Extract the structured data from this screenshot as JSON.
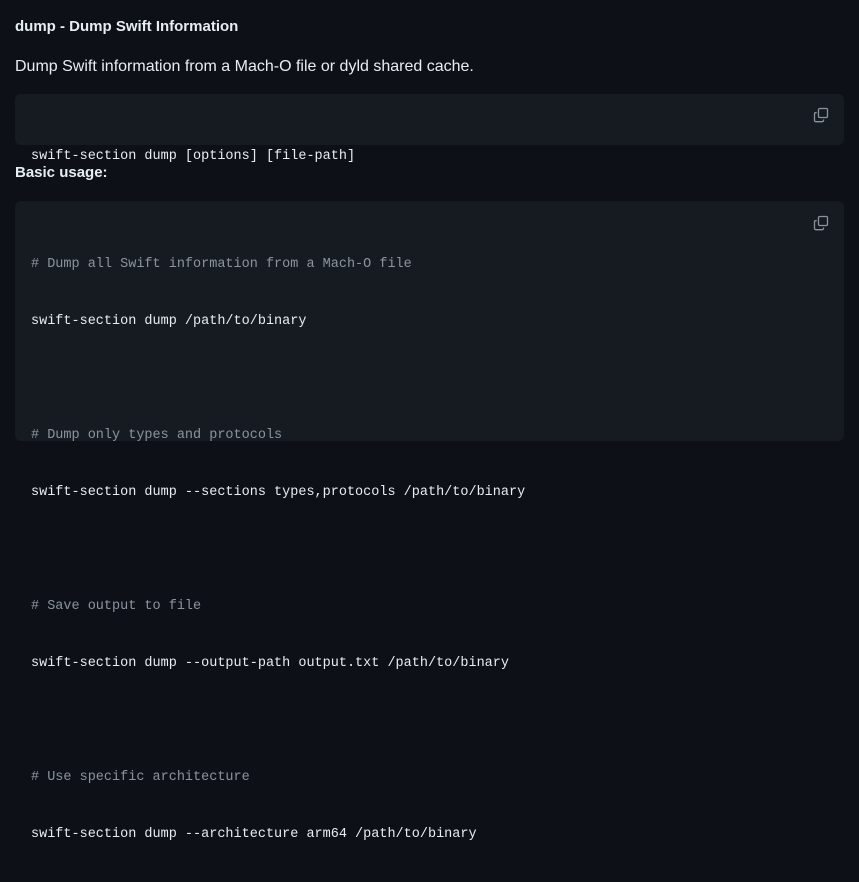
{
  "section": {
    "heading": "dump - Dump Swift Information",
    "description": "Dump Swift information from a Mach-O file or dyld shared cache."
  },
  "usage_block": {
    "command": "swift-section dump [options] [file-path]",
    "copy_icon": "copy-icon"
  },
  "basic_usage": {
    "heading": "Basic usage:",
    "copy_icon": "copy-icon",
    "examples": [
      {
        "comment": "# Dump all Swift information from a Mach-O file",
        "command": "swift-section dump /path/to/binary"
      },
      {
        "comment": "# Dump only types and protocols",
        "command": "swift-section dump --sections types,protocols /path/to/binary"
      },
      {
        "comment": "# Save output to file",
        "command": "swift-section dump --output-path output.txt /path/to/binary"
      },
      {
        "comment": "# Use specific architecture",
        "command": "swift-section dump --architecture arm64 /path/to/binary"
      }
    ]
  },
  "colors": {
    "page_background": "#0d1117",
    "code_background": "#161b22",
    "text": "#e6edf3",
    "comment": "#8b949e",
    "icon": "#8b949e"
  }
}
